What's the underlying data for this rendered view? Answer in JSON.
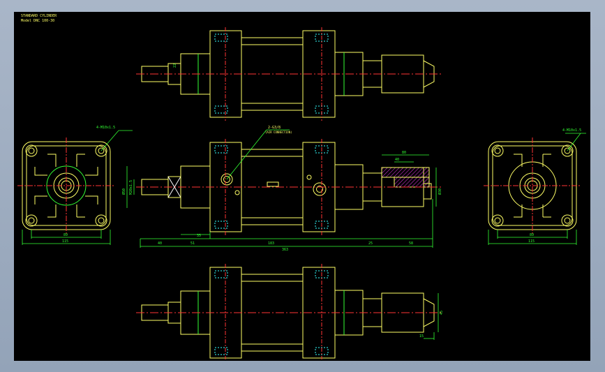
{
  "title_block": {
    "line1": "STANDARD CYLINDER",
    "line2": "Model DNC 100-30"
  },
  "notes": {
    "left_bolts": "4-M10x1.5",
    "right_bolts": "4-M10x1.5",
    "port": "2-G3/8",
    "port_sub": "(AIR CONNECTION)"
  },
  "dimensions": {
    "left_inner": "89",
    "left_outer": "115",
    "right_inner": "89",
    "right_outer": "115",
    "d40": "40",
    "d51": "51",
    "d35": "35",
    "d183": "183",
    "d363": "363",
    "d25": "25",
    "d58": "58",
    "d80": "80",
    "d40b": "40",
    "dia50": "Ø50",
    "dia30": "Ø30",
    "thread": "M20x1.5",
    "dia_rod": "Ø30",
    "top_small": "22",
    "bottom_45": "45",
    "bottom_15": "15"
  },
  "colors": {
    "outline": "#ffff66",
    "center": "#ff3333",
    "dim": "#33ff33",
    "hidden": "#33ffff",
    "white": "#ffffff",
    "hatch": "#cc33cc"
  }
}
